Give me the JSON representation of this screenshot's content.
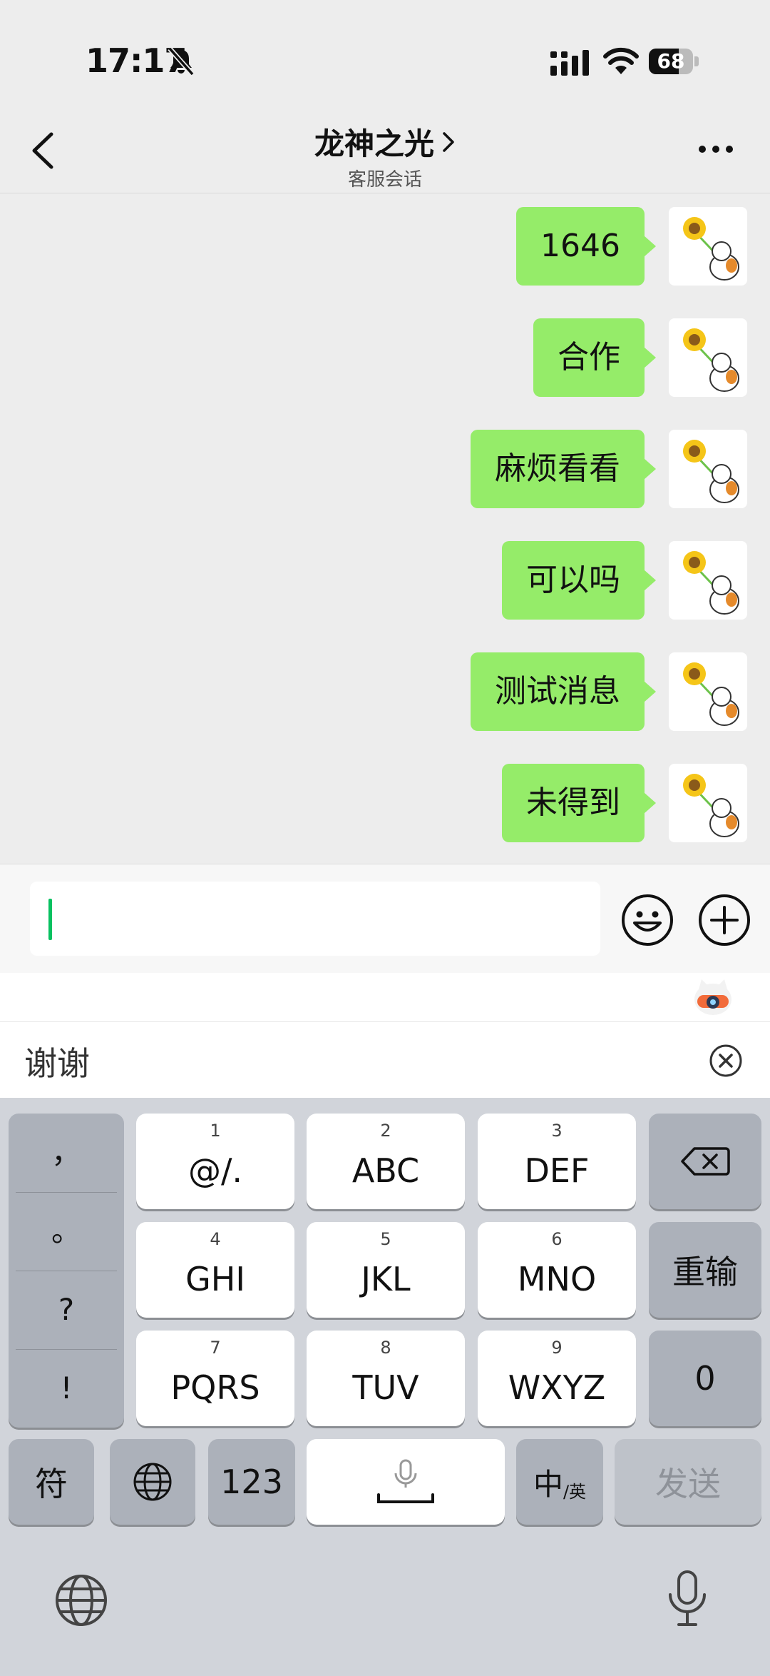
{
  "status_bar": {
    "time": "17:17",
    "battery": "68",
    "battery_level": 0.68
  },
  "nav": {
    "title": "龙神之光",
    "subtitle": "客服会话"
  },
  "messages": [
    {
      "text": "1646"
    },
    {
      "text": "合作"
    },
    {
      "text": "麻烦看看"
    },
    {
      "text": "可以吗"
    },
    {
      "text": "测试消息"
    },
    {
      "text": "未得到"
    }
  ],
  "input": {
    "value": ""
  },
  "suggestion": {
    "word": "谢谢"
  },
  "keyboard": {
    "punctuation": [
      "，",
      "。",
      "?",
      "!"
    ],
    "rows": [
      [
        {
          "num": "1",
          "letters": "@/."
        },
        {
          "num": "2",
          "letters": "ABC"
        },
        {
          "num": "3",
          "letters": "DEF"
        }
      ],
      [
        {
          "num": "4",
          "letters": "GHI"
        },
        {
          "num": "5",
          "letters": "JKL"
        },
        {
          "num": "6",
          "letters": "MNO"
        }
      ],
      [
        {
          "num": "7",
          "letters": "PQRS"
        },
        {
          "num": "8",
          "letters": "TUV"
        },
        {
          "num": "9",
          "letters": "WXYZ"
        }
      ]
    ],
    "retype_label": "重输",
    "zero_label": "0",
    "symbols_label": "符",
    "numbers_label": "123",
    "lang_main": "中",
    "lang_sub": "/英",
    "send_label": "发送"
  },
  "colors": {
    "bubble": "#95EC69",
    "accent": "#07C160",
    "keyboard_bg": "#D1D4DA"
  }
}
